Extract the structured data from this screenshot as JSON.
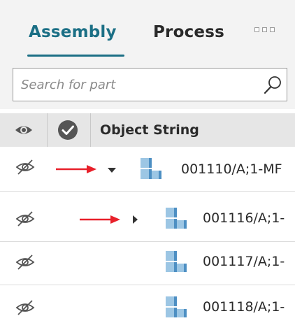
{
  "tabs": [
    {
      "label": "Assembly",
      "active": true
    },
    {
      "label": "Process",
      "active": false
    }
  ],
  "more_icon": "more-options-icon",
  "search": {
    "placeholder": "Search for part",
    "icon": "search-icon"
  },
  "table": {
    "columns": {
      "visibility_icon": "eye-icon",
      "status_icon": "check-circle-icon",
      "object_string": "Object String"
    },
    "rows": [
      {
        "object_string": "001110/A;1-MF",
        "visibility": "hidden",
        "expander": "expanded",
        "annotated": true
      },
      {
        "object_string": "001116/A;1-",
        "visibility": "hidden",
        "expander": "collapsed",
        "annotated": true
      },
      {
        "object_string": "001117/A;1-",
        "visibility": "hidden",
        "expander": "none",
        "annotated": false
      },
      {
        "object_string": "001118/A;1-",
        "visibility": "hidden",
        "expander": "none",
        "annotated": false
      }
    ]
  },
  "colors": {
    "accent": "#1b6f85",
    "annotation_arrow": "#e8202a",
    "part_icon_light": "#9cc6e4",
    "part_icon_dark": "#4d8fc3"
  }
}
